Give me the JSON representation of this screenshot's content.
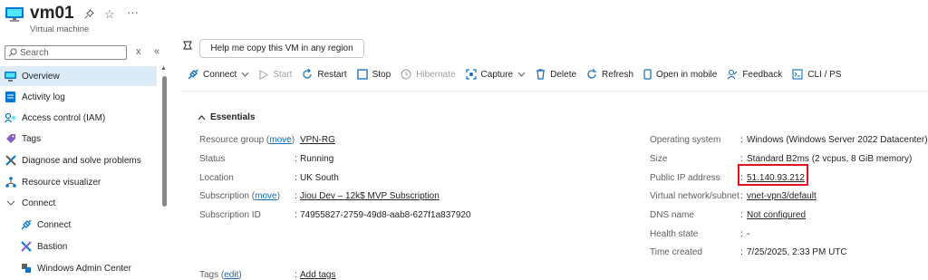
{
  "header": {
    "title": "vm01",
    "subtitle": "Virtual machine",
    "icons": [
      "pin-icon",
      "star-icon",
      "more-icon"
    ],
    "more": "···"
  },
  "sidebar": {
    "search_placeholder": "Search",
    "close_glyph": "x",
    "collapse_glyph": "«",
    "items": [
      {
        "label": "Overview",
        "icon": "overview-icon",
        "selected": true
      },
      {
        "label": "Activity log",
        "icon": "activity-log-icon"
      },
      {
        "label": "Access control (IAM)",
        "icon": "iam-icon"
      },
      {
        "label": "Tags",
        "icon": "tag-icon"
      },
      {
        "label": "Diagnose and solve problems",
        "icon": "diagnose-icon"
      },
      {
        "label": "Resource visualizer",
        "icon": "visualizer-icon"
      },
      {
        "label": "Connect",
        "icon": "chevron-down-icon",
        "expanded": true
      },
      {
        "label": "Connect",
        "icon": "connect-icon",
        "sub": true
      },
      {
        "label": "Bastion",
        "icon": "bastion-icon",
        "sub": true
      },
      {
        "label": "Windows Admin Center",
        "icon": "admin-center-icon",
        "sub": true
      }
    ]
  },
  "copilot": {
    "prompt": "Help me copy this VM in any region"
  },
  "toolbar": {
    "connect": "Connect",
    "start": "Start",
    "restart": "Restart",
    "stop": "Stop",
    "hibernate": "Hibernate",
    "capture": "Capture",
    "delete": "Delete",
    "refresh": "Refresh",
    "open_mobile": "Open in mobile",
    "feedback": "Feedback",
    "cli": "CLI / PS"
  },
  "essentials": {
    "heading": "Essentials",
    "left": [
      {
        "label": "Resource group",
        "move": "move",
        "sep": ":",
        "value": "VPN-RG",
        "link": true
      },
      {
        "label": "Status",
        "sep": ":",
        "value": "Running"
      },
      {
        "label": "Location",
        "sep": ":",
        "value": "UK South"
      },
      {
        "label": "Subscription",
        "move": "move",
        "sep": ":",
        "value": "Jiou Dev – 12k$ MVP Subscription",
        "link": true
      },
      {
        "label": "Subscription ID",
        "sep": ":",
        "value": "74955827-2759-49d8-aab8-627f1a837920"
      }
    ],
    "tags": {
      "label": "Tags",
      "edit": "edit",
      "sep": ":",
      "value": "Add tags"
    },
    "right": [
      {
        "label": "Operating system",
        "sep": ":",
        "value": "Windows (Windows Server 2022 Datacenter)"
      },
      {
        "label": "Size",
        "sep": ":",
        "value": "Standard B2ms (2 vcpus, 8 GiB memory)"
      },
      {
        "label": "Public IP address",
        "sep": ":",
        "value": "51.140.93.212",
        "link": true,
        "highlighted": true
      },
      {
        "label": "Virtual network/subnet",
        "sep": ":",
        "value": "vnet-vpn3/default",
        "link": true
      },
      {
        "label": "DNS name",
        "sep": ":",
        "value": "Not configured",
        "link": true
      },
      {
        "label": "Health state",
        "sep": ":",
        "value": "-"
      },
      {
        "label": "Time created",
        "sep": ":",
        "value": "7/25/2025, 2:33 PM UTC"
      }
    ]
  },
  "colors": {
    "accent": "#0f6cbd",
    "selected_bg": "#dcebf8",
    "highlight_border": "#e81123"
  }
}
